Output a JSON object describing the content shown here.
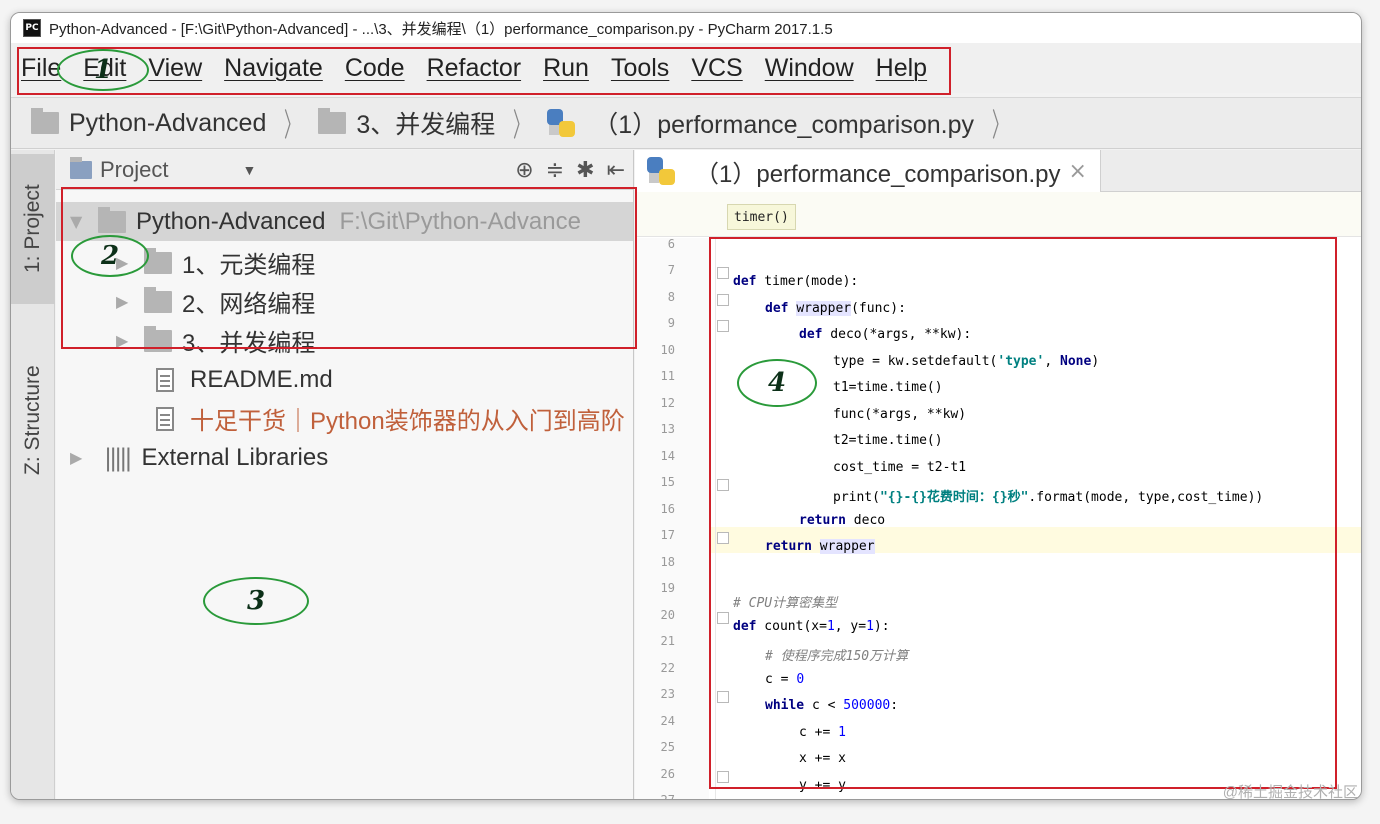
{
  "window": {
    "title": "Python-Advanced - [F:\\Git\\Python-Advanced] - ...\\3、并发编程\\（1）performance_comparison.py - PyCharm 2017.1.5",
    "app_icon": "PC"
  },
  "menu": [
    "File",
    "Edit",
    "View",
    "Navigate",
    "Code",
    "Refactor",
    "Run",
    "Tools",
    "VCS",
    "Window",
    "Help"
  ],
  "breadcrumb": [
    "Python-Advanced",
    "3、并发编程",
    "（1）performance_comparison.py"
  ],
  "toolstrip": {
    "project_tab": "1: Project",
    "structure_tab": "Z: Structure"
  },
  "project_panel": {
    "title": "Project",
    "tree": [
      {
        "label": "Python-Advanced",
        "path": "F:\\Git\\Python-Advance"
      },
      {
        "label": "1、元类编程"
      },
      {
        "label": "2、网络编程"
      },
      {
        "label": "3、并发编程"
      },
      {
        "label": "README.md"
      },
      {
        "label": "十足干货｜Python装饰器的从入门到高阶"
      },
      {
        "label": "External Libraries"
      }
    ]
  },
  "editor": {
    "tab_label": "（1）performance_comparison.py",
    "hint": "timer()",
    "line_numbers": [
      "6",
      "7",
      "8",
      "9",
      "10",
      "11",
      "12",
      "13",
      "14",
      "15",
      "16",
      "17",
      "18",
      "19",
      "20",
      "21",
      "22",
      "23",
      "24",
      "25",
      "26",
      "27"
    ],
    "code": {
      "l7_kw": "def",
      "l7_rest": " timer(mode):",
      "l8_kw": "def",
      "l8_name": "wrapper",
      "l8_rest": "(func):",
      "l9_kw": "def",
      "l9_rest": " deco(*args, **kw):",
      "l10_a": "type = kw.setdefault(",
      "l10_str": "'type'",
      "l10_b": ", ",
      "l10_kw": "None",
      "l10_c": ")",
      "l11": "t1=time.time()",
      "l12": "func(*args, **kw)",
      "l13": "t2=time.time()",
      "l14": "cost_time = t2-t1",
      "l15_a": "print(",
      "l15_str": "\"{}-{}花费时间：{}秒\"",
      "l15_b": ".format(mode, type,cost_time))",
      "l16_kw": "return",
      "l16_rest": " deco",
      "l17_kw": "return",
      "l17_name": "wrapper",
      "l19": "# CPU计算密集型",
      "l20_kw": "def",
      "l20_a": " count(x=",
      "l20_n1": "1",
      "l20_b": ", y=",
      "l20_n2": "1",
      "l20_c": "):",
      "l21": "# 使程序完成150万计算",
      "l22_a": "c = ",
      "l22_n": "0",
      "l23_kw": "while",
      "l23_a": " c < ",
      "l23_n": "500000",
      "l23_b": ":",
      "l24_a": "c += ",
      "l24_n": "1",
      "l25": "x += x",
      "l26": "y += y"
    }
  },
  "annotations": [
    "1",
    "2",
    "3",
    "4"
  ],
  "watermark": "@稀土掘金技术社区"
}
